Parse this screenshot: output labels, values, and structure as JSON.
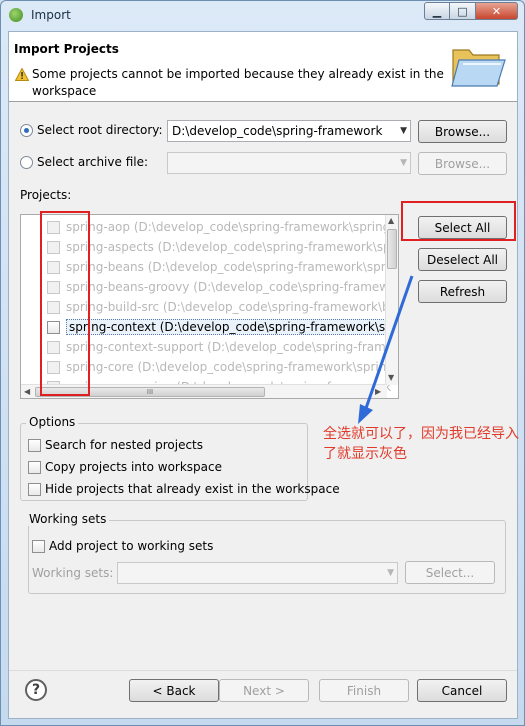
{
  "window": {
    "title": "Import",
    "minimize": "▁",
    "maximize": "□",
    "close": "✕"
  },
  "header": {
    "title": "Import Projects",
    "message": "Some projects cannot be imported because they already exist in the workspace"
  },
  "source": {
    "root_dir_label": "Select root directory:",
    "root_dir_value": "D:\\develop_code\\spring-framework",
    "archive_label": "Select archive file:",
    "browse": "Browse...",
    "browse_disabled": "Browse..."
  },
  "projects": {
    "label": "Projects:",
    "items": [
      "spring-aop (D:\\develop_code\\spring-framework\\spring-a",
      "spring-aspects (D:\\develop_code\\spring-framework\\sprin",
      "spring-beans (D:\\develop_code\\spring-framework\\sprin",
      "spring-beans-groovy (D:\\develop_code\\spring-framework",
      "spring-build-src (D:\\develop_code\\spring-framework\\bu",
      "spring-context (D:\\develop_code\\spring-framework\\spri",
      "spring-context-support (D:\\develop_code\\spring-frame",
      "spring-core (D:\\develop_code\\spring-framework\\spring-",
      "spring-expression (D:\\develop_code\\spring-framework"
    ],
    "select_all": "Select All",
    "deselect_all": "Deselect All",
    "refresh": "Refresh",
    "scroll_mark": "III"
  },
  "annotation": {
    "text": "全选就可以了，因为我已经导入了就显示灰色",
    "color": "#e23a2a"
  },
  "options": {
    "title": "Options",
    "search_nested": "Search for nested projects",
    "copy_projects": "Copy projects into workspace",
    "hide_projects": "Hide projects that already exist in the workspace"
  },
  "working_sets": {
    "title": "Working sets",
    "add_label": "Add project to working sets",
    "sets_label": "Working sets:",
    "select": "Select..."
  },
  "footer": {
    "help": "?",
    "back": "< Back",
    "next": "Next >",
    "finish": "Finish",
    "cancel": "Cancel"
  }
}
